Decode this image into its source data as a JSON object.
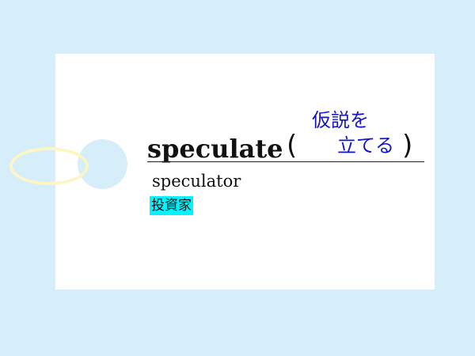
{
  "card": {
    "headword": "speculate",
    "paren_open": "(",
    "paren_close": ")",
    "meaning_line1": "仮説を",
    "meaning_line2": "立てる",
    "derived_word": "speculator",
    "derived_meaning": "投資家"
  },
  "colors": {
    "background": "#d6eef9",
    "card": "#ffffff",
    "ring": "#fbf6c4",
    "meaning_text": "#1515c8",
    "highlight": "#00f5ff"
  }
}
